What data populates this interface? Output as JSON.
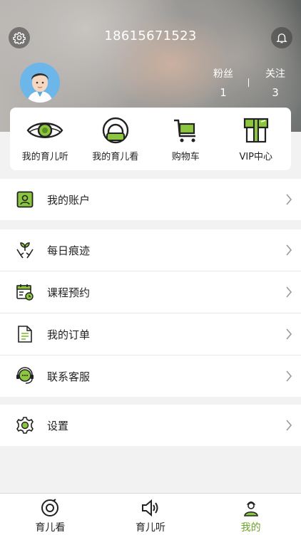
{
  "header": {
    "phone": "18615671523",
    "settings_icon": "gear-icon",
    "notification_icon": "bell-icon",
    "fans_label": "粉丝",
    "fans_count": "1",
    "follow_label": "关注",
    "follow_count": "3",
    "separator": "|"
  },
  "quick": [
    {
      "label": "我的育儿听",
      "icon": "eye-icon"
    },
    {
      "label": "我的育儿看",
      "icon": "headphones-icon"
    },
    {
      "label": "购物车",
      "icon": "cart-icon"
    },
    {
      "label": "VIP中心",
      "icon": "vip-box-icon"
    }
  ],
  "menu": {
    "account": "我的账户",
    "daily": "每日痕迹",
    "course": "课程预约",
    "orders": "我的订单",
    "service": "联系客服",
    "settings": "设置"
  },
  "tabs": [
    {
      "label": "育儿看",
      "icon": "play-circle-icon"
    },
    {
      "label": "育儿听",
      "icon": "speaker-icon"
    },
    {
      "label": "我的",
      "icon": "person-icon",
      "active": true
    }
  ],
  "colors": {
    "accent": "#6ba32a",
    "accent_light": "#8cc63f"
  }
}
